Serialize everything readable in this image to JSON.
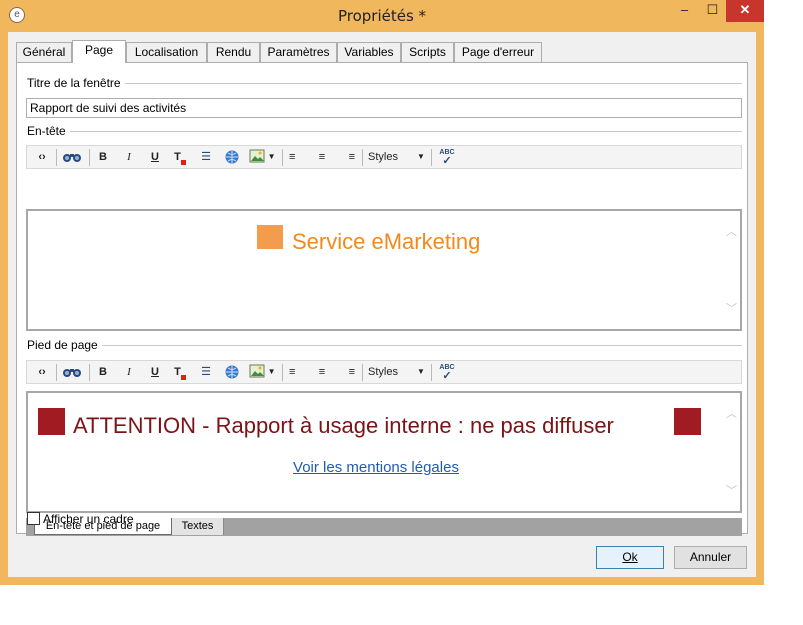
{
  "window": {
    "title": "Propriétés *",
    "minimize": "–",
    "maximize": "☐",
    "close": "✕"
  },
  "tabs": [
    {
      "label": "Général"
    },
    {
      "label": "Page"
    },
    {
      "label": "Localisation"
    },
    {
      "label": "Rendu"
    },
    {
      "label": "Paramètres"
    },
    {
      "label": "Variables"
    },
    {
      "label": "Scripts"
    },
    {
      "label": "Page d'erreur"
    }
  ],
  "active_tab": "Page",
  "window_title_section": {
    "label": "Titre de la fenêtre",
    "value": "Rapport de suivi des activités"
  },
  "header_section": {
    "label": "En-tête",
    "text": "Service eMarketing",
    "styles_label": "Styles"
  },
  "footer_section": {
    "label": "Pied de page",
    "text": "ATTENTION - Rapport à usage interne : ne pas diffuser",
    "link": "Voir les mentions légales",
    "styles_label": "Styles"
  },
  "toolbar": {
    "source": "‹›",
    "find": "🔍",
    "bold": "B",
    "italic": "I",
    "underline": "U",
    "color": "T",
    "list": "☰",
    "link": "🌐",
    "image": "▣",
    "align_left": "≡",
    "align_center": "≡",
    "align_right": "≡",
    "spell": "ABC"
  },
  "bottom_tabs": [
    {
      "label": "En-tête et pied de page"
    },
    {
      "label": "Textes"
    }
  ],
  "frame_checkbox": {
    "label": "Afficher un cadre",
    "checked": false
  },
  "buttons": {
    "ok": "Ok",
    "cancel": "Annuler"
  },
  "colors": {
    "titlebar": "#f0b75d",
    "header_square": "#f39c4e",
    "header_text": "#f08a1b",
    "footer_square": "#a11c22",
    "footer_text": "#7c1317",
    "link": "#1f5bb6"
  }
}
